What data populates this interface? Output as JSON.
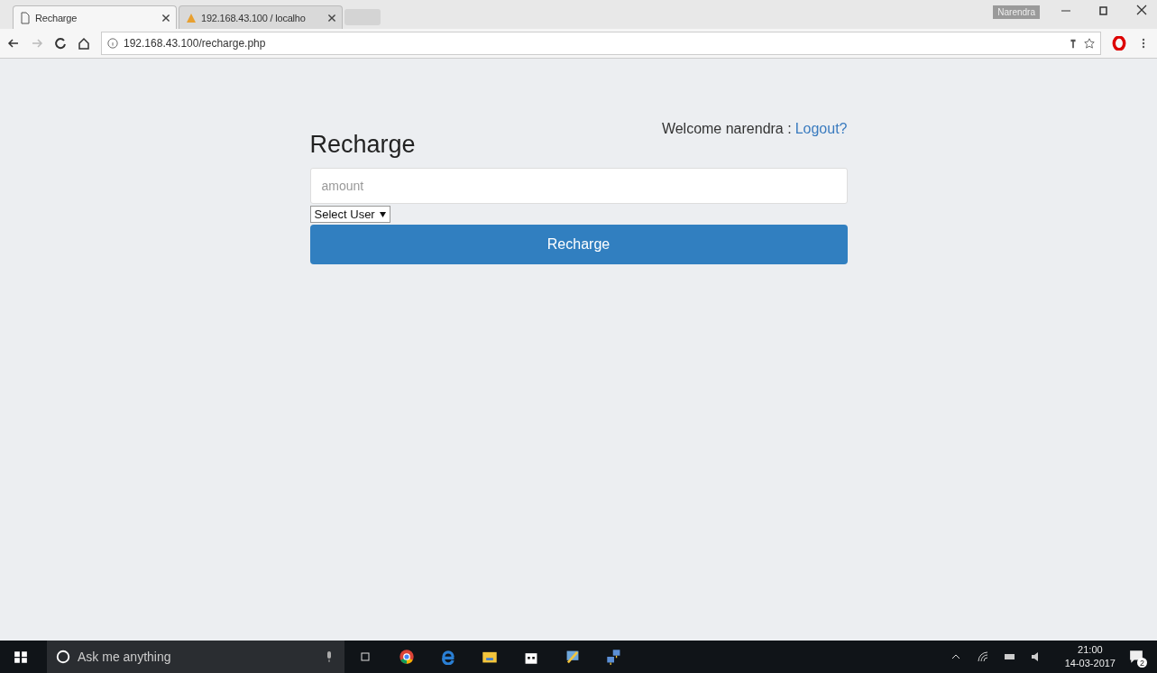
{
  "browser": {
    "tabs": [
      {
        "title": "Recharge",
        "selected": true
      },
      {
        "title": "192.168.43.100 / localho",
        "selected": false
      }
    ],
    "profile": "Narendra",
    "url": "192.168.43.100/recharge.php"
  },
  "page": {
    "welcome": "Welcome narendra :",
    "logout": "Logout?",
    "heading": "Recharge",
    "amount": {
      "placeholder": "amount"
    },
    "user_select": "Select User",
    "submit": "Recharge"
  },
  "taskbar": {
    "search": {
      "placeholder": "Ask me anything"
    },
    "time": "21:00",
    "date": "14-03-2017",
    "notifications": "2"
  }
}
